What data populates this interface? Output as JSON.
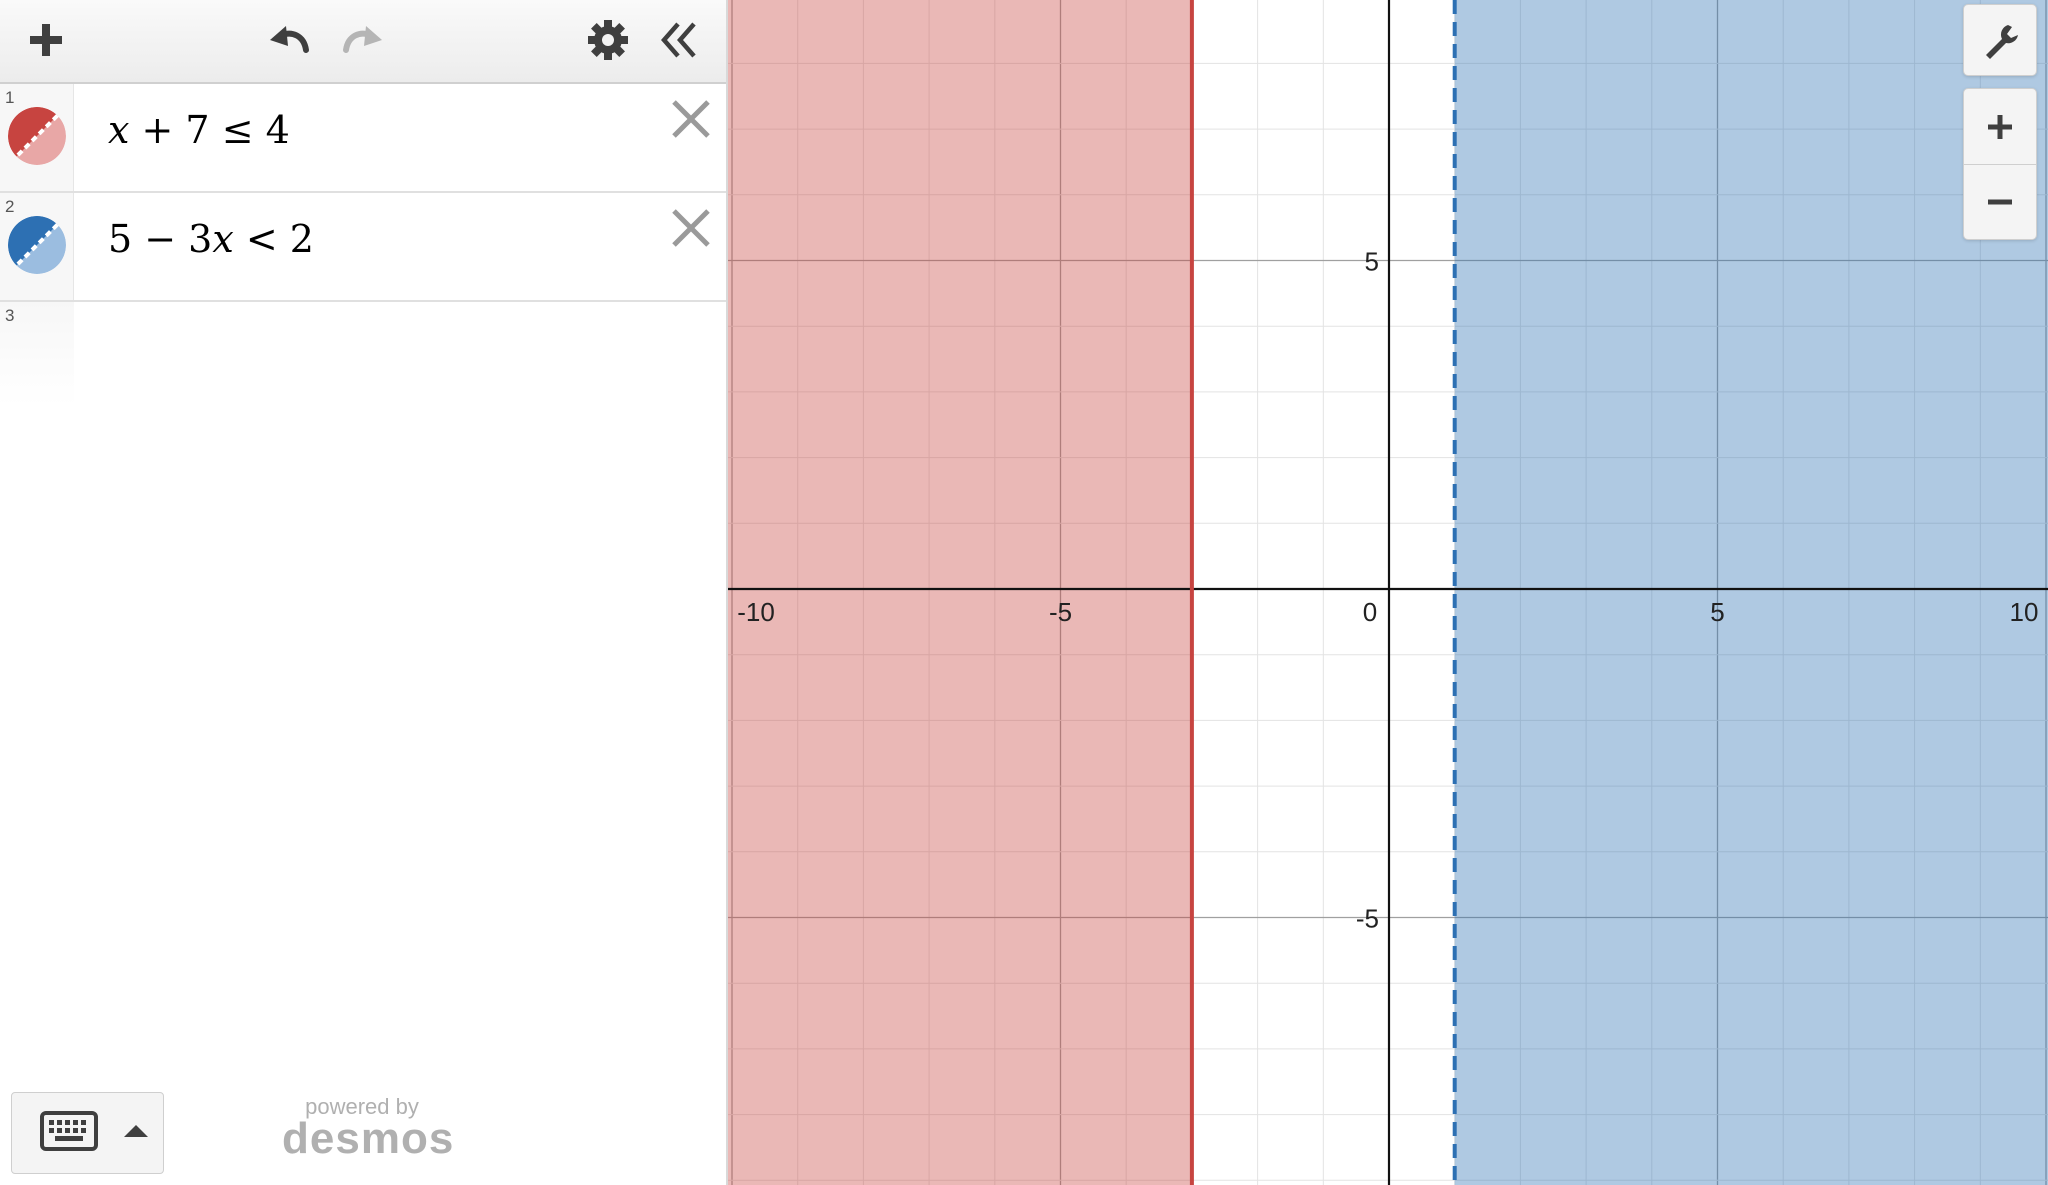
{
  "toolbar": {
    "add_icon": "plus-icon",
    "undo_icon": "undo-icon",
    "redo_icon": "redo-icon",
    "settings_icon": "gear-icon",
    "collapse_icon": "double-chevron-left-icon"
  },
  "expressions": [
    {
      "index": "1",
      "parts": [
        "x",
        " + 7 ≤ 4"
      ],
      "color": "#c74440",
      "fill": "#e8a7a6"
    },
    {
      "index": "2",
      "parts": [
        "5 − 3",
        "x",
        " < 2"
      ],
      "color": "#2d70b3",
      "fill": "#9bbde0"
    },
    {
      "index": "3",
      "parts": []
    }
  ],
  "footer": {
    "keyboard_icon": "keyboard-icon",
    "powered_by": "powered by",
    "brand": "desmos"
  },
  "graph": {
    "x_ticks": [
      "-10",
      "-5",
      "0",
      "5",
      "10"
    ],
    "y_ticks": [
      "5",
      "-5"
    ],
    "regions": [
      {
        "name": "x ≤ -3",
        "boundary_x": -3,
        "side": "left",
        "line": "solid",
        "color": "#c74440",
        "fill": "#e8b2b3"
      },
      {
        "name": "x > 1",
        "boundary_x": 1,
        "side": "right",
        "line": "dashed",
        "color": "#2d70b3",
        "fill": "#a9c5e1"
      }
    ],
    "x_range": [
      -10,
      10
    ],
    "y_range": [
      -9,
      9
    ],
    "grid": true
  },
  "controls": {
    "wrench_icon": "wrench-icon",
    "zoom_in_icon": "zoom-in-icon",
    "zoom_out_icon": "zoom-out-icon"
  }
}
